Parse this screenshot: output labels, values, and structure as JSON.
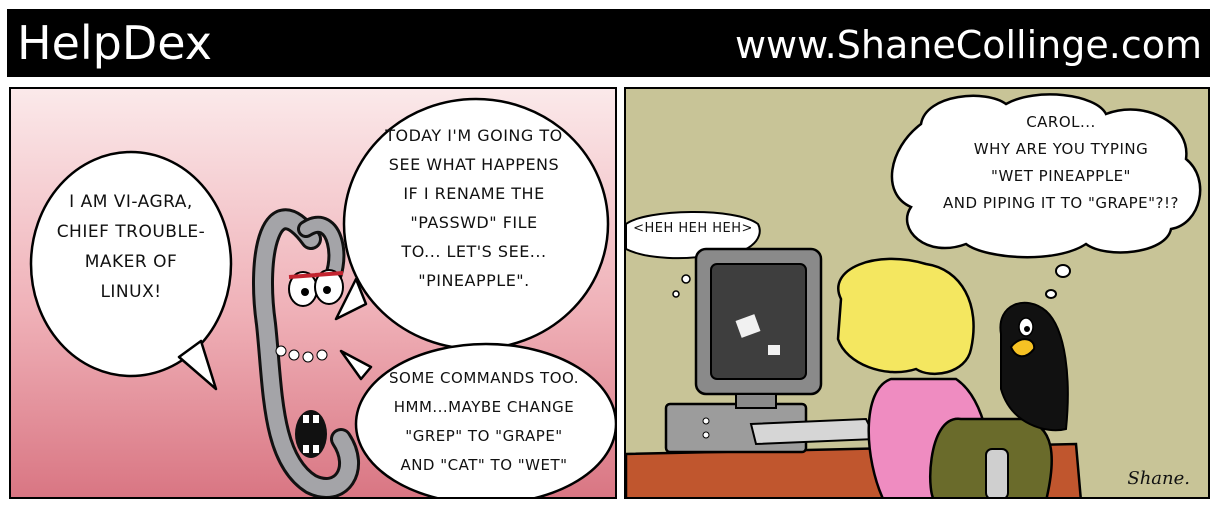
{
  "header": {
    "title": "HelpDex",
    "url": "www.ShaneCollinge.com"
  },
  "panel_left": {
    "bubble_viagra": "I AM VI-AGRA,\nCHIEF TROUBLE-\nMAKER OF\nLINUX!",
    "bubble_plan": "TODAY I'M GOING TO\nSEE WHAT HAPPENS\nIF I RENAME THE\n\"PASSWD\" FILE\nTO... LET'S SEE...\n\"PINEAPPLE\".",
    "bubble_commands": "SOME COMMANDS TOO.\nHMM...MAYBE CHANGE\n\"GREP\" TO \"GRAPE\"\nAND \"CAT\" TO \"WET\""
  },
  "panel_right": {
    "thought_heh": "<HEH HEH HEH>",
    "thought_carol": "CAROL...\nWHY ARE YOU TYPING\n\"WET PINEAPPLE\"\nAND PIPING IT TO \"GRAPE\"?!?",
    "signature": "Shane."
  }
}
